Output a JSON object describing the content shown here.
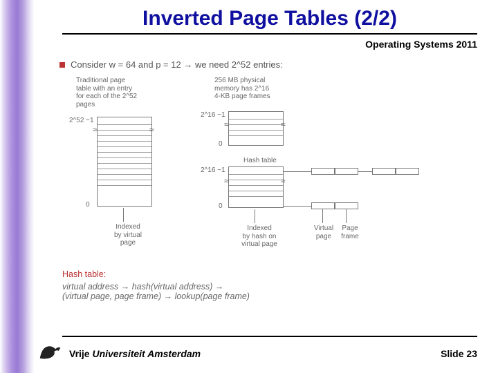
{
  "title": "Inverted Page Tables (2/2)",
  "subheader": "Operating Systems 2011",
  "consider_line": "Consider w = 64 and p = 12 → we need 2^52 entries:",
  "diagram": {
    "trad_label": "Traditional page\ntable with an entry\nfor each of the 2^52\npages",
    "phys_label": "256 MB physical\nmemory has 2^16\n4-KB page frames",
    "top_left_index": "2^52 −1",
    "mid_left_index": "2^16 −1",
    "zero": "0",
    "hash_table_label": "Hash table",
    "hash_index": "2^16 −1",
    "indexed_virtual": "Indexed\nby virtual\npage",
    "indexed_hash": "Indexed\nby hash on\nvirtual page",
    "virtual_page": "Virtual\npage",
    "page_frame": "Page\nframe"
  },
  "hash_section": {
    "title": "Hash table:",
    "line1": "virtual address → hash(virtual address) →",
    "line2": "(virtual page, page frame) → lookup(page frame)"
  },
  "footer": {
    "university_plain": "Vrije ",
    "university_italic": "Universiteit Amsterdam",
    "slide_label": "Slide",
    "slide_number": "23"
  }
}
